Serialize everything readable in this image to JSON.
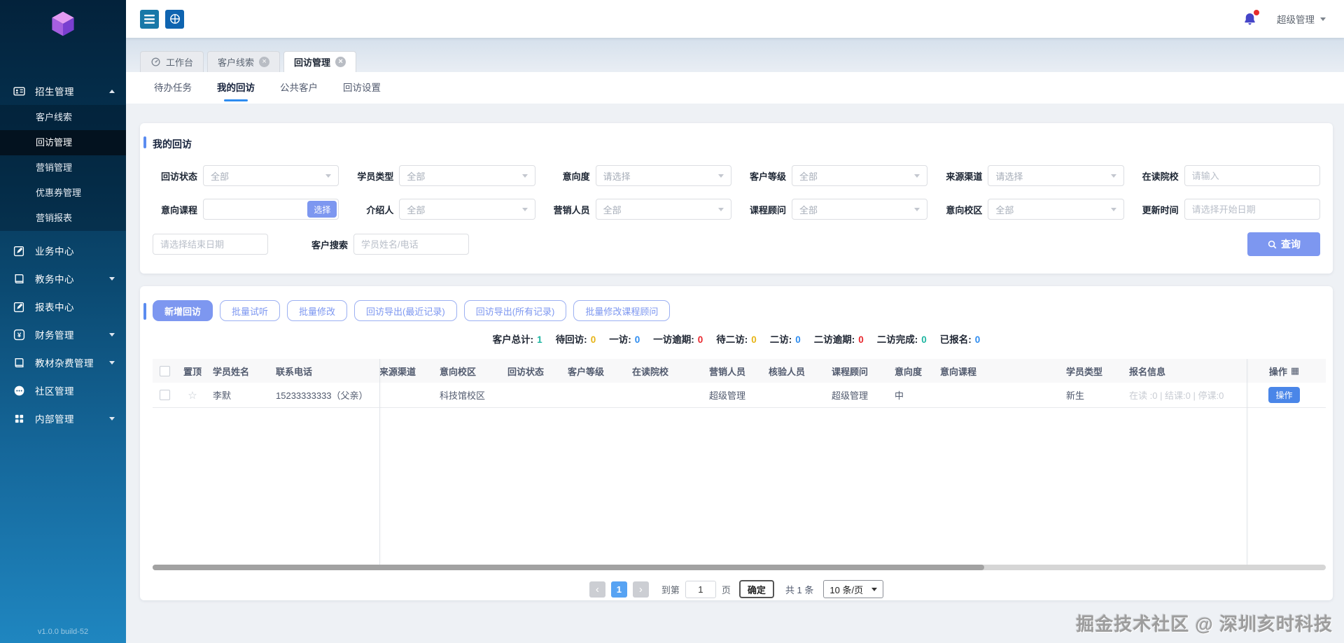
{
  "app": {
    "version": "v1.0.0 build-52",
    "watermark": "掘金技术社区 @ 深圳亥时科技"
  },
  "icons": {
    "close": "×",
    "star": "☆",
    "grid": "▦",
    "prev": "‹",
    "next": "›"
  },
  "topbar": {
    "user_name": "超级管理"
  },
  "sidebar": {
    "sections": [
      {
        "label": "招生管理",
        "icon": "id-card-icon"
      },
      {
        "label": "业务中心",
        "icon": "edit-icon"
      },
      {
        "label": "教务中心",
        "icon": "book-icon"
      },
      {
        "label": "报表中心",
        "icon": "edit-icon"
      },
      {
        "label": "财务管理",
        "icon": "yen-icon"
      },
      {
        "label": "教材杂费管理",
        "icon": "book-icon"
      },
      {
        "label": "社区管理",
        "icon": "chat-icon"
      },
      {
        "label": "内部管理",
        "icon": "grid-icon"
      }
    ],
    "submenu": [
      {
        "label": "客户线索"
      },
      {
        "label": "回访管理",
        "active": true
      },
      {
        "label": "营销管理"
      },
      {
        "label": "优惠券管理"
      },
      {
        "label": "营销报表"
      }
    ]
  },
  "tabs": [
    {
      "label": "工作台",
      "icon": "dashboard-icon",
      "closable": false
    },
    {
      "label": "客户线索",
      "closable": true
    },
    {
      "label": "回访管理",
      "closable": true,
      "active": true
    }
  ],
  "subtabs": [
    {
      "label": "待办任务"
    },
    {
      "label": "我的回访",
      "active": true
    },
    {
      "label": "公共客户"
    },
    {
      "label": "回访设置"
    }
  ],
  "filter": {
    "title": "我的回访",
    "row1": [
      {
        "label": "回访状态",
        "value": "全部"
      },
      {
        "label": "学员类型",
        "value": "全部"
      },
      {
        "label": "意向度",
        "value": "请选择"
      },
      {
        "label": "客户等级",
        "value": "全部"
      },
      {
        "label": "来源渠道",
        "value": "请选择"
      },
      {
        "label": "在读院校",
        "placeholder": "请输入"
      }
    ],
    "row2": [
      {
        "label": "意向课程",
        "button": "选择"
      },
      {
        "label": "介绍人",
        "value": "全部"
      },
      {
        "label": "营销人员",
        "value": "全部"
      },
      {
        "label": "课程顾问",
        "value": "全部"
      },
      {
        "label": "意向校区",
        "value": "全部"
      },
      {
        "label": "更新时间",
        "placeholder": "请选择开始日期"
      }
    ],
    "row3": {
      "end_date_placeholder": "请选择结束日期",
      "search_label": "客户搜索",
      "search_placeholder": "学员姓名/电话",
      "query_label": "查询"
    },
    "accent_color": "#7d97f0"
  },
  "toolbar": {
    "buttons": [
      {
        "label": "新增回访",
        "primary": true
      },
      {
        "label": "批量试听"
      },
      {
        "label": "批量修改"
      },
      {
        "label": "回访导出(最近记录)"
      },
      {
        "label": "回访导出(所有记录)"
      },
      {
        "label": "批量修改课程顾问"
      }
    ]
  },
  "stats": [
    {
      "label": "客户总计:",
      "value": "1",
      "color": "#1db5a0"
    },
    {
      "label": "待回访:",
      "value": "0",
      "color": "#e7b416"
    },
    {
      "label": "一访:",
      "value": "0",
      "color": "#2d8cf0"
    },
    {
      "label": "一访逾期:",
      "value": "0",
      "color": "#e8262d"
    },
    {
      "label": "待二访:",
      "value": "0",
      "color": "#e7b416"
    },
    {
      "label": "二访:",
      "value": "0",
      "color": "#2d8cf0"
    },
    {
      "label": "二访逾期:",
      "value": "0",
      "color": "#e8262d"
    },
    {
      "label": "二访完成:",
      "value": "0",
      "color": "#1db5a0"
    },
    {
      "label": "已报名:",
      "value": "0",
      "color": "#2d8cf0"
    }
  ],
  "table": {
    "columns": [
      "置顶",
      "学员姓名",
      "联系电话",
      "来源渠道",
      "意向校区",
      "回访状态",
      "客户等级",
      "在读院校",
      "营销人员",
      "核验人员",
      "课程顾问",
      "意向度",
      "意向课程",
      "学员类型",
      "报名信息",
      "操作"
    ],
    "row": {
      "student_name": "李默",
      "phone": "15233333333（父亲）",
      "source_channel": "",
      "intent_campus": "科技馆校区",
      "visit_status": "",
      "customer_level": "",
      "school": "",
      "marketer": "超级管理",
      "verifier": "",
      "course_advisor": "超级管理",
      "intent_level": "中",
      "intent_course": "",
      "student_type": "新生",
      "enroll_info": "在读 :0 | 结课:0 | 停课:0",
      "action_label": "操作"
    }
  },
  "pagination": {
    "current_page": "1",
    "goto_label": "到第",
    "goto_value": "1",
    "page_unit": "页",
    "confirm_label": "确定",
    "total_label": "共 1 条",
    "page_size_label": "10 条/页"
  }
}
